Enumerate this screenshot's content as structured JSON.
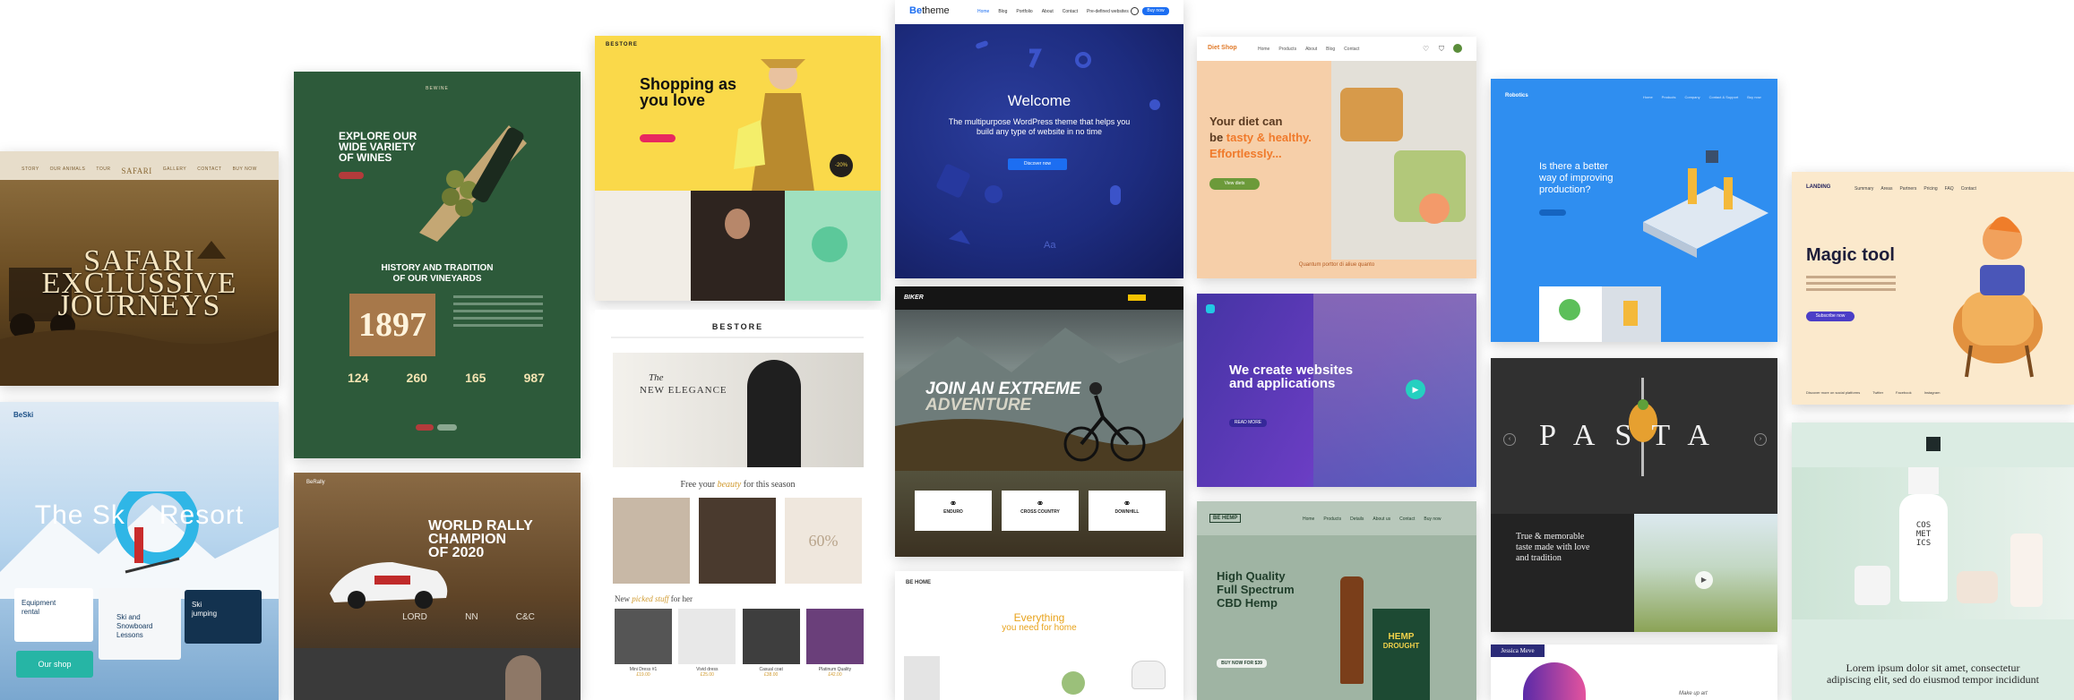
{
  "betheme_bar": {
    "logo_be": "Be",
    "logo_text": "theme",
    "links": [
      "Home",
      "Blog",
      "Portfolio",
      "About",
      "Contact",
      "Pre-defined websites"
    ],
    "buy": "Buy now"
  },
  "safari": {
    "nav": [
      "STORY",
      "OUR ANIMALS",
      "TOUR",
      "GALLERY",
      "CONTACT",
      "BUY NOW"
    ],
    "logo": "SAFARI",
    "title1": "SAFARI",
    "title2": "EXCLUSSIVE",
    "title3": "JOURNEYS"
  },
  "wine": {
    "logo": "BEWINE",
    "headline1": "EXPLORE OUR",
    "headline2": "WIDE VARIETY",
    "headline3": "OF WINES",
    "section1": "HISTORY AND TRADITION",
    "section2": "OF OUR VINEYARDS",
    "year": "1897",
    "stats": [
      "124",
      "260",
      "165",
      "987"
    ]
  },
  "shopping": {
    "logo": "BESTORE",
    "headline1": "Shopping as",
    "headline2": "you love",
    "badge": "-20%"
  },
  "store2": {
    "logo": "BESTORE",
    "hero1": "The",
    "hero2": "NEW ELEGANCE",
    "free1": "Free your ",
    "free2": "beauty",
    "free3": " for this season",
    "percent": "60%",
    "picked1": "New ",
    "picked2": "picked stuff",
    "picked3": " for her",
    "products": [
      "Mini Dress #1",
      "Vivid dress",
      "Casual coat",
      "Platinum Quality"
    ],
    "prices": [
      "£19.00",
      "£25.00",
      "£38.00",
      "£42.00"
    ]
  },
  "welcome": {
    "title": "Welcome",
    "sub1": "The multipurpose WordPress theme that helps you",
    "sub2": "build any type of website in no time",
    "button": "Discover now",
    "aa": "Aa"
  },
  "biker": {
    "logo": "BIKER",
    "headline1": "JOIN AN EXTREME",
    "headline2": "ADVENTURE",
    "cards": [
      "ENDURO",
      "CROSS COUNTRY",
      "DOWNHILL"
    ]
  },
  "home": {
    "logo": "BE HOME",
    "headline1": "Everything",
    "headline2": "you need for home"
  },
  "diet": {
    "logo": "Diet Shop",
    "nav": [
      "Home",
      "Products",
      "About",
      "Blog",
      "Contact"
    ],
    "line1": "Your diet can",
    "line2a": "be ",
    "line2b": "tasty & healthy.",
    "line3": "Effortlessly... ",
    "button": "View diets",
    "footer": "Quantum porttor di aliue quanto"
  },
  "webdev": {
    "headline1": "We create websites",
    "headline2": "and applications",
    "button": "READ MORE"
  },
  "hemp": {
    "logo": "BE HEMP",
    "nav": [
      "Home",
      "Products",
      "Details",
      "About us",
      "Contact",
      "Buy now"
    ],
    "h1": "High Quality",
    "h2": "Full Spectrum",
    "h3": "CBD Hemp",
    "button": "BUY NOW FOR $39",
    "bottle_label": "HEMP",
    "bottle_sub": "DROUGHT"
  },
  "robotics": {
    "logo": "Robotics",
    "nav": [
      "Home",
      "Products",
      "Company",
      "Contact & Support",
      "Buy now"
    ],
    "q1": "Is there a better",
    "q2": "way of improving",
    "q3": "production?"
  },
  "pasta": {
    "title": "PASTA",
    "text1": "True & memorable",
    "text2": "taste made with love",
    "text3": "and tradition"
  },
  "landing": {
    "logo": "LANDING",
    "nav": [
      "Summary",
      "Areas",
      "Partners",
      "Pricing",
      "FAQ",
      "Contact"
    ],
    "title": "Magic tool",
    "button": "Subscribe now",
    "footer": [
      "Discover more on social platforms",
      "Twitter",
      "Facebook",
      "Instagram"
    ]
  },
  "cosmetics": {
    "label1": "COS",
    "label2": "MET",
    "label3": "ICS",
    "lorem1": "Lorem ipsum dolor sit amet, consectetur",
    "lorem2": "adipiscing elit, sed do eiusmod tempor incididunt"
  },
  "ski": {
    "logo": "BeSki",
    "title1": "The Sk",
    "title2": "Resort",
    "card1a": "Equipment",
    "card1b": "rental",
    "card2a": "Ski and",
    "card2b": "Snowboard",
    "card2c": "Lessons",
    "card3a": "Ski",
    "card3b": "jumping",
    "shop": "Our shop"
  },
  "rally": {
    "logo": "BeRally",
    "h1": "WORLD RALLY",
    "h2": "CHAMPION",
    "h3": "OF 2020",
    "sponsors": [
      "LORD",
      "NN",
      "C&C"
    ]
  },
  "beauty": {
    "name": "Jessica Meve",
    "makeup": "Make up art"
  },
  "colors": {
    "wine_green": "#2d5a3a",
    "shopping_yellow": "#fad94a",
    "welcome_blue": "#1d2c7f",
    "diet_peach": "#f6cfa9",
    "robotics_blue": "#2f8ef0",
    "hemp_sage": "#9fb4a3",
    "cosmetics_mint": "#dbece3",
    "ski_sky": "#b9d6ee",
    "pasta_dark": "#303030",
    "landing_cream": "#fbe9cc",
    "webdev_purple": "#4c38a8"
  }
}
